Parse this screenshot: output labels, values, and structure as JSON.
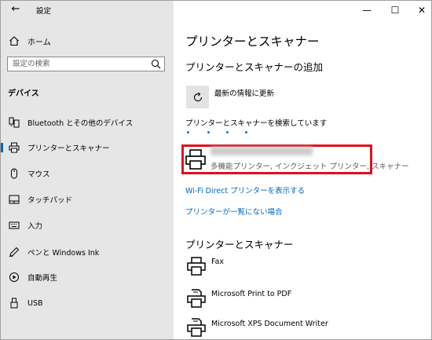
{
  "window": {
    "title": "設定",
    "minimize": "—",
    "maximize": "☐",
    "close": "✕"
  },
  "sidebar": {
    "home_label": "ホーム",
    "search_placeholder": "設定の検索",
    "section_title": "デバイス",
    "items": [
      {
        "label": "Bluetooth とその他のデバイス",
        "icon": "bluetooth-devices-icon"
      },
      {
        "label": "プリンターとスキャナー",
        "icon": "printer-icon",
        "active": true
      },
      {
        "label": "マウス",
        "icon": "mouse-icon"
      },
      {
        "label": "タッチパッド",
        "icon": "touchpad-icon"
      },
      {
        "label": "入力",
        "icon": "keyboard-icon"
      },
      {
        "label": "ペンと Windows Ink",
        "icon": "pen-icon"
      },
      {
        "label": "自動再生",
        "icon": "autoplay-icon"
      },
      {
        "label": "USB",
        "icon": "usb-icon"
      }
    ]
  },
  "main": {
    "page_title": "プリンターとスキャナー",
    "add_heading": "プリンターとスキャナーの追加",
    "refresh_label": "最新の情報に更新",
    "searching_text": "プリンターとスキャナーを検索しています",
    "found_device": {
      "description": "多機能プリンター, インクジェット プリンター, スキャナー"
    },
    "wifi_direct_link": "Wi-Fi Direct プリンターを表示する",
    "not_listed_link": "プリンターが一覧にない場合",
    "list_heading": "プリンターとスキャナー",
    "printers": [
      {
        "name": "Fax",
        "icon": "fax-printer-icon"
      },
      {
        "name": "Microsoft Print to PDF",
        "icon": "pdf-printer-icon"
      },
      {
        "name": "Microsoft XPS Document Writer",
        "icon": "xps-printer-icon"
      }
    ]
  },
  "colors": {
    "accent": "#0067b8",
    "highlight_border": "#e0101e",
    "sidebar_bg": "#e6e6e6"
  }
}
